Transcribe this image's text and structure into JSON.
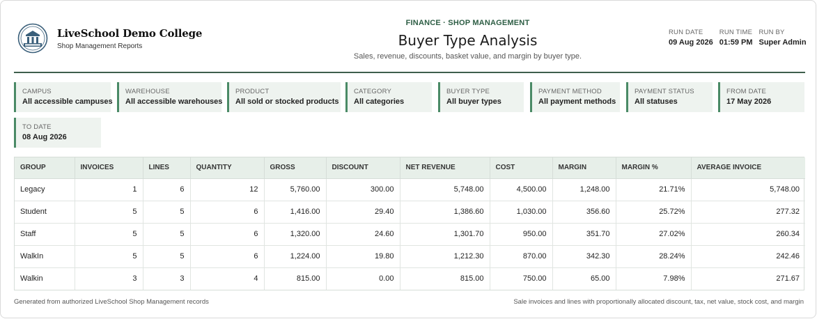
{
  "brand": {
    "name": "LiveSchool Demo College",
    "subtitle": "Shop Management Reports",
    "logo_icon": "college-crest-icon"
  },
  "report": {
    "kicker": "FINANCE · SHOP MANAGEMENT",
    "title": "Buyer Type Analysis",
    "subtitle": "Sales, revenue, discounts, basket value, and margin by buyer type."
  },
  "meta": [
    {
      "label": "RUN DATE",
      "value": "09 Aug 2026"
    },
    {
      "label": "RUN TIME",
      "value": "01:59 PM"
    },
    {
      "label": "RUN BY",
      "value": "Super Admin"
    }
  ],
  "filters": [
    {
      "label": "CAMPUS",
      "value": "All accessible campuses"
    },
    {
      "label": "WAREHOUSE",
      "value": "All accessible warehouses"
    },
    {
      "label": "PRODUCT",
      "value": "All sold or stocked products"
    },
    {
      "label": "CATEGORY",
      "value": "All categories"
    },
    {
      "label": "BUYER TYPE",
      "value": "All buyer types"
    },
    {
      "label": "PAYMENT METHOD",
      "value": "All payment methods"
    },
    {
      "label": "PAYMENT STATUS",
      "value": "All statuses"
    },
    {
      "label": "FROM DATE",
      "value": "17 May 2026"
    },
    {
      "label": "TO DATE",
      "value": "08 Aug 2026"
    }
  ],
  "table": {
    "columns": [
      "GROUP",
      "INVOICES",
      "LINES",
      "QUANTITY",
      "GROSS",
      "DISCOUNT",
      "NET REVENUE",
      "COST",
      "MARGIN",
      "MARGIN %",
      "AVERAGE INVOICE"
    ],
    "rows": [
      [
        "Legacy",
        "1",
        "6",
        "12",
        "5,760.00",
        "300.00",
        "5,748.00",
        "4,500.00",
        "1,248.00",
        "21.71%",
        "5,748.00"
      ],
      [
        "Student",
        "5",
        "5",
        "6",
        "1,416.00",
        "29.40",
        "1,386.60",
        "1,030.00",
        "356.60",
        "25.72%",
        "277.32"
      ],
      [
        "Staff",
        "5",
        "5",
        "6",
        "1,320.00",
        "24.60",
        "1,301.70",
        "950.00",
        "351.70",
        "27.02%",
        "260.34"
      ],
      [
        "WalkIn",
        "5",
        "5",
        "6",
        "1,224.00",
        "19.80",
        "1,212.30",
        "870.00",
        "342.30",
        "28.24%",
        "242.46"
      ],
      [
        "Walkin",
        "3",
        "3",
        "4",
        "815.00",
        "0.00",
        "815.00",
        "750.00",
        "65.00",
        "7.98%",
        "271.67"
      ]
    ]
  },
  "footer": {
    "left": "Generated from authorized LiveSchool Shop Management records",
    "right": "Sale invoices and lines with proportionally allocated discount, tax, net value, stock cost, and margin"
  },
  "colors": {
    "accent": "#2e5e45",
    "chip_bg": "#eef3ef",
    "chip_border": "#4a8a66",
    "table_header_bg": "#e7efe9"
  }
}
